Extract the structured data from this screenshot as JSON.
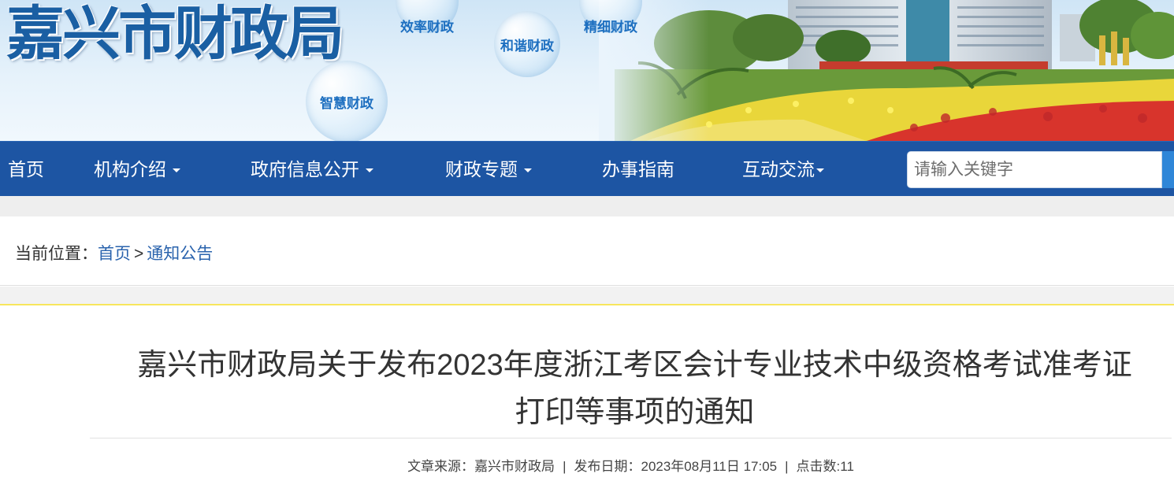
{
  "header": {
    "site_title": "嘉兴市财政局",
    "bubbles": [
      "效率财政",
      "精细财政",
      "和谐财政",
      "智慧财政"
    ]
  },
  "nav": {
    "items": [
      {
        "label": "首页",
        "has_dropdown": false
      },
      {
        "label": "机构介绍",
        "has_dropdown": true
      },
      {
        "label": "政府信息公开",
        "has_dropdown": true
      },
      {
        "label": "财政专题",
        "has_dropdown": true
      },
      {
        "label": "办事指南",
        "has_dropdown": false
      },
      {
        "label": "互动交流",
        "has_dropdown": true
      }
    ],
    "search_placeholder": "请输入关键字"
  },
  "breadcrumb": {
    "prefix": "当前位置：",
    "home": "首页",
    "separator": ">",
    "current": "通知公告"
  },
  "article": {
    "title_line1": "嘉兴市财政局关于发布2023年度浙江考区会计专业技术中级资格考试准考证",
    "title_line2": "打印等事项的通知",
    "source_label": "文章来源：",
    "source": "嘉兴市财政局",
    "date_label": "发布日期：",
    "date": "2023年08月11日 17:05",
    "clicks_label": "点击数:",
    "clicks": "11"
  },
  "colors": {
    "nav_bg": "#1d55a3",
    "link": "#2a63ad",
    "accent_line": "#f7e65c"
  }
}
